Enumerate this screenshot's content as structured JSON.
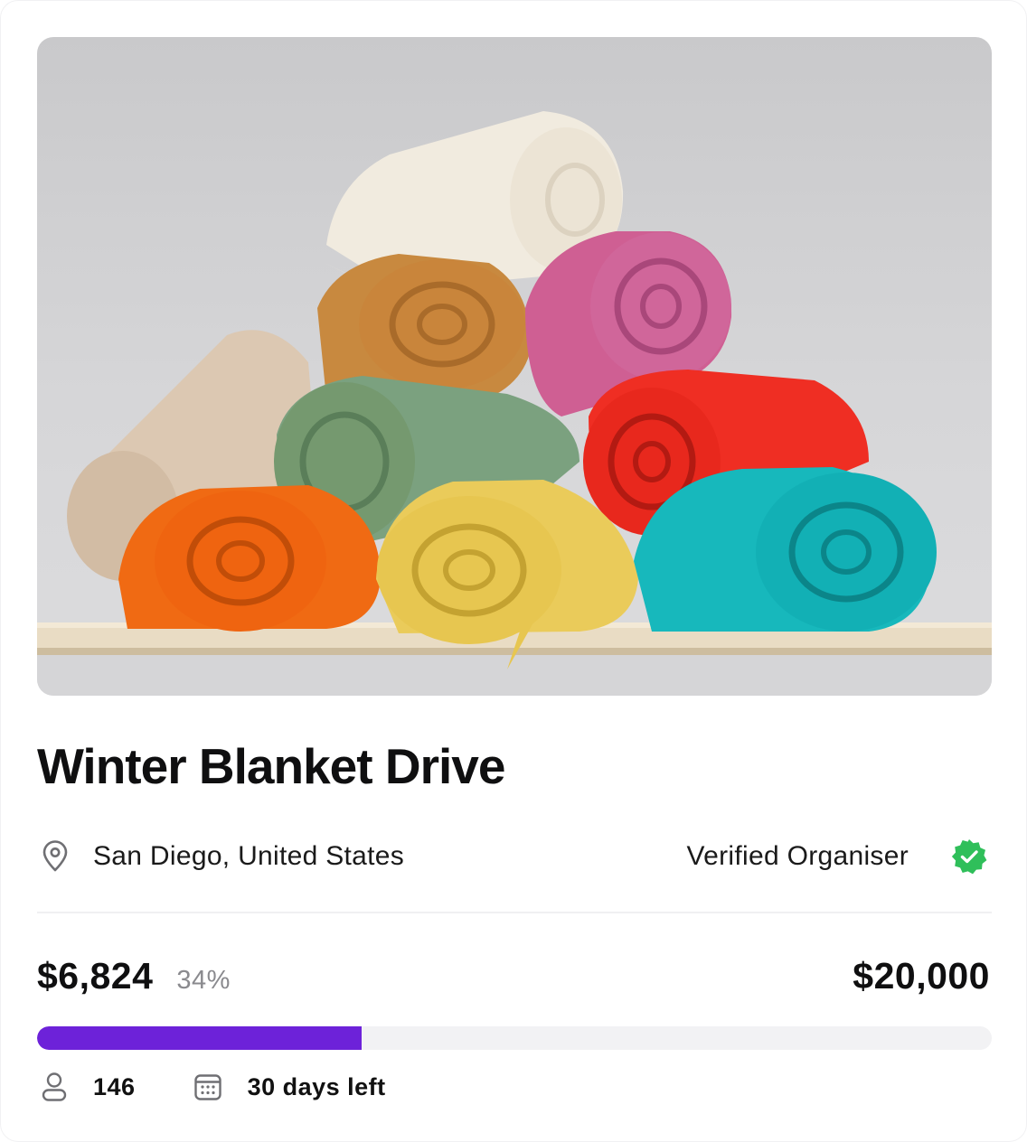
{
  "campaign": {
    "title": "Winter Blanket Drive",
    "image_alt": "Stack of rolled colourful wool blankets on a wooden shelf",
    "location": "San Diego, United States",
    "organiser_status": "Verified Organiser",
    "raised": "$6,824",
    "percent": "34%",
    "progress": 0.34,
    "goal": "$20,000",
    "supporters": "146",
    "time_left": "30 days left"
  },
  "colors": {
    "accent": "#6d22d9",
    "verified": "#2fbf5a",
    "track": "#f2f2f4",
    "muted": "#8a8a8e"
  },
  "icons": {
    "location": "map-pin-icon",
    "verified": "verified-badge-icon",
    "supporters": "user-icon",
    "time": "calendar-icon"
  }
}
